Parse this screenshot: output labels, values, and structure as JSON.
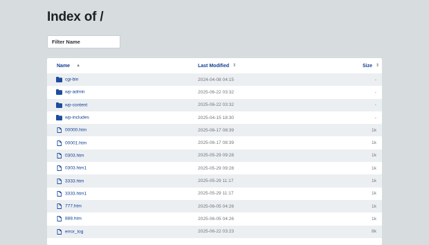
{
  "page": {
    "title": "Index of /",
    "filter_placeholder": "Filter Name"
  },
  "table": {
    "headers": {
      "name": "Name",
      "modified": "Last Modified",
      "size": "Size"
    },
    "sort_icons": {
      "name": "ascending-sort-icon",
      "modified": "sort-icon",
      "size": "sort-icon"
    },
    "rows": [
      {
        "type": "folder",
        "name": "cgi-bin",
        "modified": "2024-04-08 04:15",
        "size": "-"
      },
      {
        "type": "folder",
        "name": "wp-admin",
        "modified": "2025-06-22 03:32",
        "size": "-"
      },
      {
        "type": "folder",
        "name": "wp-content",
        "modified": "2025-06-22 03:32",
        "size": "-"
      },
      {
        "type": "folder",
        "name": "wp-includes",
        "modified": "2025-04-15 18:30",
        "size": "-"
      },
      {
        "type": "file",
        "name": "00000.htm",
        "modified": "2025-06-17 08:39",
        "size": "1k"
      },
      {
        "type": "file",
        "name": "00001.htm",
        "modified": "2025-06-17 08:39",
        "size": "1k"
      },
      {
        "type": "file",
        "name": "0303.htm",
        "modified": "2025-05-29 09:28",
        "size": "1k"
      },
      {
        "type": "file",
        "name": "0303.htm1",
        "modified": "2025-05-29 09:28",
        "size": "1k"
      },
      {
        "type": "file",
        "name": "3333.htm",
        "modified": "2025-05-29 11:17",
        "size": "1k"
      },
      {
        "type": "file",
        "name": "3333.htm1",
        "modified": "2025-05-29 11:17",
        "size": "1k"
      },
      {
        "type": "file",
        "name": "777.htm",
        "modified": "2025-06-05 04:26",
        "size": "1k"
      },
      {
        "type": "file",
        "name": "888.htm",
        "modified": "2025-06-05 04:26",
        "size": "1k"
      },
      {
        "type": "file",
        "name": "error_log",
        "modified": "2025-06-22 03:23",
        "size": "8k"
      }
    ]
  },
  "colors": {
    "background": "#d7dcdf",
    "link": "#0f3e90",
    "row_alt": "#eceff2",
    "folder_icon": "#1d4e9e",
    "file_icon": "#1d4e9e"
  }
}
